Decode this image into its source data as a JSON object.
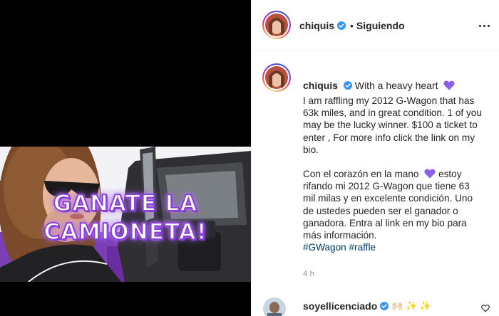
{
  "post": {
    "overlay": {
      "line1": "GANATE LA",
      "line2": "CAMIONETA!"
    }
  },
  "header": {
    "username": "chiquis",
    "separator": "•",
    "follow_status": "Siguiendo"
  },
  "caption": {
    "username": "chiquis",
    "lead": "With a heavy heart",
    "paragraph_en": "I am raffling my 2012 G-Wagon that has 63k miles, and in great condition. 1 of you may be the lucky winner. $100 a ticket to enter , For more info click the link on my bio.",
    "paragraph_es_start": "Con el corazón en la mano",
    "paragraph_es_rest": "estoy rifando mi 2012 G-Wagon que tiene 63 mil milas y en excelente condición. Uno de ustedes pueden ser el ganador o ganadora. Entra al link en my bio para más información.",
    "hashtags": [
      "#GWagon",
      "#raffle"
    ],
    "time": "4 h"
  },
  "reply": {
    "username": "soyellicenciado",
    "emojis": "🙌🏻 ✨ ✨"
  },
  "colors": {
    "verified": "#3897f0",
    "heart_purple": "#8f5fe8",
    "hashtag": "#00376b",
    "overlay_stroke": "#8a3fd6"
  },
  "icons": {
    "verified": "verified-badge-icon",
    "heart": "purple-heart-icon",
    "more": "more-options-icon",
    "like": "heart-outline-icon"
  }
}
